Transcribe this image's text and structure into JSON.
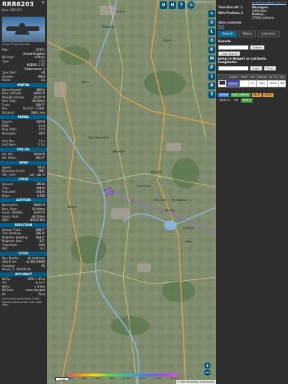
{
  "aircraft": {
    "callsign": "RRR6203",
    "hex_label": "Hex:",
    "hex": "43C171",
    "photo_credit": "Image © Type Unknow",
    "details": [
      {
        "k": "Reg.:",
        "v": "ZZ171"
      },
      {
        "k": "",
        "v": "United Kingdom"
      },
      {
        "k": "DB flags:",
        "v": "military"
      },
      {
        "k": "Type:",
        "v": "C17"
      },
      {
        "k": "",
        "v": "BOEING C-17"
      },
      {
        "k": "",
        "v": "Globemaster 3"
      },
      {
        "k": "Type Desc.:",
        "v": "L4J"
      },
      {
        "k": "Squawk:",
        "v": "0624"
      },
      {
        "k": "Route:",
        "v": "n/a"
      }
    ],
    "sections": [
      {
        "title": "SPATIAL",
        "rows": [
          {
            "k": "Groundspeed:",
            "v": "385 kt"
          },
          {
            "k": "Baro. altitude:",
            "v": "34000 ft"
          },
          {
            "k": "WGS84 altitude:",
            "v": "35350 ft"
          },
          {
            "k": "Vert. Rate:",
            "v": "64 ft/min"
          },
          {
            "k": "Track:",
            "v": "290.7°"
          },
          {
            "k": "Pos.:",
            "v": "50.474°, 7.094°"
          },
          {
            "k": "Distance:",
            "v": "188.1 nmi"
          }
        ]
      },
      {
        "title": "SIGNAL",
        "rows": [
          {
            "k": "Source:",
            "v": "ADS-B"
          },
          {
            "k": "RSSI:",
            "v": "-21.6"
          },
          {
            "k": "Msg. Rate:",
            "v": "10.5"
          },
          {
            "k": "Messages:",
            "v": "1472"
          },
          {
            "k": "",
            "v": ""
          },
          {
            "k": "Last Pos.:",
            "v": "1.4 s"
          },
          {
            "k": "Last Seen:",
            "v": "1.0 s"
          }
        ]
      },
      {
        "title": "FMS SEL",
        "rows": [
          {
            "k": "Sel. Alt.:",
            "v": "34016 ft"
          },
          {
            "k": "Sel. Head.:",
            "v": "281.2°"
          }
        ]
      },
      {
        "title": "WIND",
        "rows": [
          {
            "k": "Speed:",
            "v": "67 kt"
          },
          {
            "k": "Direction (from):",
            "v": "261°"
          },
          {
            "k": "TAT / OAT:",
            "v": "-20 / -46 °C"
          }
        ]
      },
      {
        "title": "SPEED",
        "rows": [
          {
            "k": "Ground:",
            "v": "385 kt"
          },
          {
            "k": "True:",
            "v": "444 kt"
          },
          {
            "k": "Indicated:",
            "v": "261 kt"
          },
          {
            "k": "Mach:",
            "v": "0.756"
          }
        ]
      },
      {
        "title": "ALTITUDE",
        "rows": [
          {
            "k": "Barometric:",
            "v": "34000 ft"
          },
          {
            "k": "Baro. Rate:",
            "v": "64 ft/min"
          },
          {
            "k": "Geom. WGS84:",
            "v": "35350 ft"
          },
          {
            "k": "Geom. Rate:",
            "v": "-64 ft/min"
          },
          {
            "k": "QNH:",
            "v": "1013.6 hPa"
          }
        ]
      },
      {
        "title": "DIRECTION",
        "rows": [
          {
            "k": "Ground Track:",
            "v": "290.7°"
          },
          {
            "k": "True Heading:",
            "v": "286.4°"
          },
          {
            "k": "Magnetic Heading:",
            "v": "283.2°"
          },
          {
            "k": "Magnetic Decl.:",
            "v": "3.2°"
          },
          {
            "k": "Track Rate:",
            "v": "-0.03"
          },
          {
            "k": "Roll:",
            "v": "-0.2"
          }
        ]
      },
      {
        "title": "STUFF",
        "rows": [
          {
            "k": "Nav. Modes:",
            "v": "alt_hold,tcas"
          },
          {
            "k": "ADS-B Ver.:",
            "v": "v2 (DO-260B)"
          },
          {
            "k": "Category:",
            "v": "A5"
          },
          {
            "k": "Heavy (> 300000 lb)",
            "v": ""
          }
        ]
      },
      {
        "title": "ACCURACY",
        "rows": [
          {
            "k": "NACp:",
            "v": "EPU < 30 m"
          },
          {
            "k": "SIL:",
            "v": "≤ 1e-7"
          },
          {
            "k": "NACv:",
            "v": "< 3 m/s"
          },
          {
            "k": "NICbaro:",
            "v": "cross-checked"
          },
          {
            "k": "Rc:",
            "v": "75 m"
          }
        ]
      }
    ],
    "footnote": "Learn more about Mode S data type by hovering over each data label."
  },
  "map": {
    "side_buttons": [
      "<",
      "O",
      "L",
      "O",
      "K",
      "M",
      "P",
      "I",
      "R",
      "T"
    ],
    "top_buttons": [
      "U",
      "H",
      "T"
    ],
    "zoom_in": "+",
    "zoom_out": "−",
    "scale_label": "2 NM",
    "alt_ticks": [
      "2000",
      "4000",
      "6000",
      "8000",
      "10 000",
      "20 000",
      "30 000",
      "40 000+"
    ],
    "attribution": "© OpenStreetMap contributors",
    "top_link": "tar1090 on github: (5.5.2.1)",
    "places": [
      "Lenne",
      "Siegburg",
      "Wiehl",
      "Bonn",
      "Neuwied",
      "Koblenz",
      "Mayen",
      "Bad Neuenahr",
      "Limburg",
      "Montabaur",
      "Diez",
      "Lahnstein",
      "Bad Ems",
      "Nassau"
    ],
    "colors": {
      "trail": "#9b5bff",
      "aircraft": "#a86bff",
      "buttons": "#00547a"
    }
  },
  "stats": {
    "total_aircraft_label": "Total Aircraft:",
    "total_aircraft": "1",
    "messages_label": "Messages:",
    "messages": "2300.4/sec",
    "with_position_label": "With Position:",
    "with_position": "1",
    "history_label": "History:",
    "history": "27526 positions",
    "stats_available": "Stats available",
    "stats_link": "here"
  },
  "tabs": [
    "Search",
    "Filters",
    "Columns"
  ],
  "search": {
    "label": "Search:",
    "placeholder": "",
    "button": "Search",
    "clear_button": "Clear Search",
    "jump_label": "Jump to Airport or Latitude, Longitude:",
    "jump_button": "Jump",
    "clear": "Clear"
  },
  "table": {
    "headers": [
      "",
      "Callsign",
      "Route",
      "Type",
      "Squawk",
      "Alt. (ft)",
      "Spd."
    ],
    "rows": [
      {
        "flag": "uk",
        "callsign": "RRR6203",
        "route": "",
        "type": "C17",
        "squawk": "0624",
        "alt": "34000",
        "spd": "385"
      }
    ]
  },
  "legend": [
    "ADS-B",
    "UAT / ADS-R",
    "MLAT",
    "TIS-B",
    "Mode-S",
    "AIS",
    "ADS-C"
  ]
}
